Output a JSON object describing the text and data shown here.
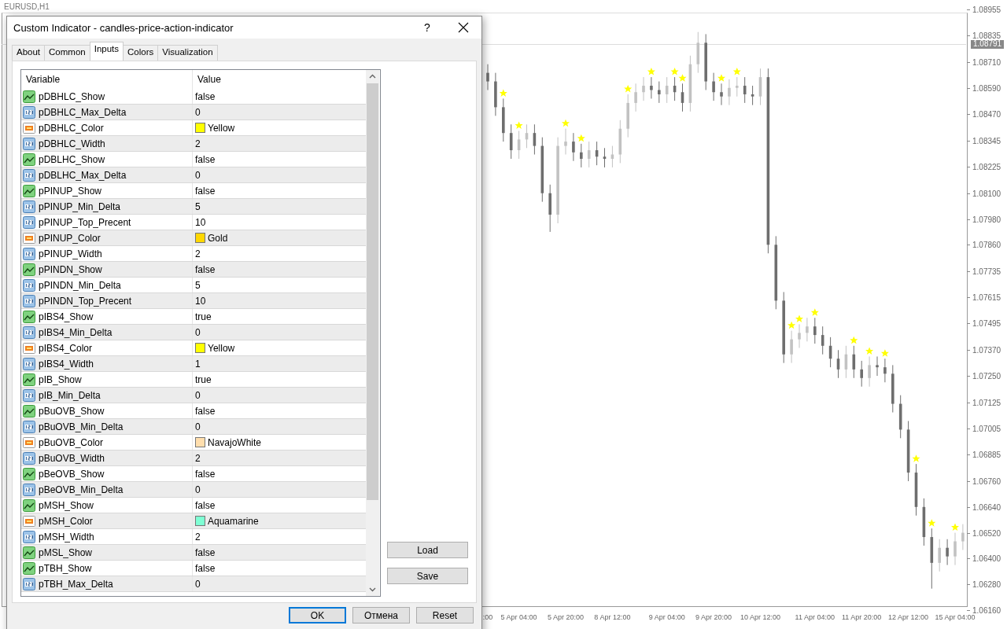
{
  "chart_window": {
    "title": "EURUSD,H1",
    "current_price": "1.08791",
    "chart_data": {
      "type": "candlestick",
      "ylim": [
        1.0616,
        1.08955
      ],
      "categories": [
        ":00",
        null,
        null,
        null,
        "5 Apr 04:00",
        null,
        null,
        null,
        null,
        null,
        "5 Apr 20:00",
        null,
        null,
        null,
        null,
        null,
        "8 Apr 12:00",
        null,
        null,
        null,
        null,
        null,
        null,
        "9 Apr 04:00",
        null,
        null,
        null,
        null,
        null,
        "9 Apr 20:00",
        null,
        null,
        null,
        null,
        null,
        "10 Apr 12:00",
        null,
        null,
        null,
        null,
        null,
        null,
        "11 Apr 04:00",
        null,
        null,
        null,
        null,
        null,
        "11 Apr 20:00",
        null,
        null,
        null,
        null,
        null,
        "12 Apr 12:00",
        null,
        null,
        null,
        null,
        null,
        "15 Apr 04:00",
        null
      ],
      "ohlc": [
        [
          1.0866,
          1.087,
          1.0858,
          1.0862
        ],
        [
          1.0862,
          1.0866,
          1.0846,
          1.085
        ],
        [
          1.085,
          1.0854,
          1.0834,
          1.0838
        ],
        [
          1.0838,
          1.0842,
          1.0826,
          1.083
        ],
        [
          1.083,
          1.0839,
          1.0826,
          1.0835
        ],
        [
          1.0835,
          1.0842,
          1.0831,
          1.0838
        ],
        [
          1.0838,
          1.0842,
          1.0828,
          1.0832
        ],
        [
          1.0832,
          1.0836,
          1.0806,
          1.081
        ],
        [
          1.081,
          1.0814,
          1.0792,
          1.08
        ],
        [
          1.08,
          1.0836,
          1.0796,
          1.0832
        ],
        [
          1.0832,
          1.084,
          1.0828,
          1.0834
        ],
        [
          1.0834,
          1.0838,
          1.0825,
          1.0829
        ],
        [
          1.0829,
          1.0833,
          1.0822,
          1.0826
        ],
        [
          1.0826,
          1.0834,
          1.0822,
          1.083
        ],
        [
          1.083,
          1.0834,
          1.0823,
          1.0827
        ],
        [
          1.0827,
          1.0831,
          1.0822,
          1.0826
        ],
        [
          1.0826,
          1.0832,
          1.0822,
          1.0828
        ],
        [
          1.0828,
          1.0844,
          1.0824,
          1.084
        ],
        [
          1.084,
          1.0856,
          1.0836,
          1.0852
        ],
        [
          1.0852,
          1.0861,
          1.0848,
          1.0857
        ],
        [
          1.0857,
          1.0864,
          1.0853,
          1.086
        ],
        [
          1.086,
          1.0864,
          1.0854,
          1.0858
        ],
        [
          1.0858,
          1.0862,
          1.0852,
          1.0856
        ],
        [
          1.0856,
          1.0864,
          1.0852,
          1.086
        ],
        [
          1.086,
          1.0864,
          1.0853,
          1.0857
        ],
        [
          1.0857,
          1.0861,
          1.0848,
          1.0852
        ],
        [
          1.0852,
          1.0874,
          1.0848,
          1.087
        ],
        [
          1.087,
          1.0885,
          1.0866,
          1.088
        ],
        [
          1.088,
          1.0884,
          1.0858,
          1.0862
        ],
        [
          1.0862,
          1.0866,
          1.0853,
          1.0857
        ],
        [
          1.0857,
          1.0861,
          1.0851,
          1.0855
        ],
        [
          1.0855,
          1.0863,
          1.0851,
          1.0859
        ],
        [
          1.0859,
          1.0864,
          1.0855,
          1.086
        ],
        [
          1.086,
          1.0864,
          1.0852,
          1.0856
        ],
        [
          1.0856,
          1.086,
          1.0851,
          1.0855
        ],
        [
          1.0855,
          1.0868,
          1.0851,
          1.0864
        ],
        [
          1.0864,
          1.0868,
          1.0782,
          1.0786
        ],
        [
          1.0786,
          1.079,
          1.0756,
          1.076
        ],
        [
          1.076,
          1.0764,
          1.0731,
          1.0735
        ],
        [
          1.0735,
          1.0746,
          1.0731,
          1.0742
        ],
        [
          1.0742,
          1.0749,
          1.0738,
          1.0745
        ],
        [
          1.0745,
          1.0752,
          1.0741,
          1.0748
        ],
        [
          1.0748,
          1.0752,
          1.074,
          1.0744
        ],
        [
          1.0744,
          1.0748,
          1.0735,
          1.0739
        ],
        [
          1.0739,
          1.0743,
          1.0729,
          1.0733
        ],
        [
          1.0733,
          1.0737,
          1.0724,
          1.0728
        ],
        [
          1.0728,
          1.0739,
          1.0724,
          1.0735
        ],
        [
          1.0735,
          1.0739,
          1.0724,
          1.0728
        ],
        [
          1.0728,
          1.0732,
          1.072,
          1.0724
        ],
        [
          1.0724,
          1.0734,
          1.072,
          1.073
        ],
        [
          1.073,
          1.0734,
          1.0725,
          1.0729
        ],
        [
          1.0729,
          1.0733,
          1.0722,
          1.0726
        ],
        [
          1.0726,
          1.073,
          1.0708,
          1.0712
        ],
        [
          1.0712,
          1.0716,
          1.0696,
          1.07
        ],
        [
          1.07,
          1.0704,
          1.0676,
          1.068
        ],
        [
          1.068,
          1.0684,
          1.066,
          1.0664
        ],
        [
          1.0664,
          1.0668,
          1.0646,
          1.065
        ],
        [
          1.065,
          1.0654,
          1.0626,
          1.0638
        ],
        [
          1.0638,
          1.0649,
          1.0634,
          1.0645
        ],
        [
          1.0645,
          1.0649,
          1.0637,
          1.0641
        ],
        [
          1.0641,
          1.0652,
          1.0637,
          1.0648
        ],
        [
          1.0648,
          1.0656,
          1.0644,
          1.0652
        ]
      ],
      "yticks": [
        {
          "value": 1.08955,
          "label": "1.08955"
        },
        {
          "value": 1.08835,
          "label": "1.08835"
        },
        {
          "value": 1.0871,
          "label": "1.08710"
        },
        {
          "value": 1.0859,
          "label": "1.08590"
        },
        {
          "value": 1.0847,
          "label": "1.08470"
        },
        {
          "value": 1.08345,
          "label": "1.08345"
        },
        {
          "value": 1.08225,
          "label": "1.08225"
        },
        {
          "value": 1.081,
          "label": "1.08100"
        },
        {
          "value": 1.0798,
          "label": "1.07980"
        },
        {
          "value": 1.0786,
          "label": "1.07860"
        },
        {
          "value": 1.07735,
          "label": "1.07735"
        },
        {
          "value": 1.07615,
          "label": "1.07615"
        },
        {
          "value": 1.07495,
          "label": "1.07495"
        },
        {
          "value": 1.0737,
          "label": "1.07370"
        },
        {
          "value": 1.0725,
          "label": "1.07250"
        },
        {
          "value": 1.07125,
          "label": "1.07125"
        },
        {
          "value": 1.07005,
          "label": "1.07005"
        },
        {
          "value": 1.06885,
          "label": "1.06885"
        },
        {
          "value": 1.0676,
          "label": "1.06760"
        },
        {
          "value": 1.0664,
          "label": "1.06640"
        },
        {
          "value": 1.0652,
          "label": "1.06520"
        },
        {
          "value": 1.064,
          "label": "1.06400"
        },
        {
          "value": 1.0628,
          "label": "1.06280"
        },
        {
          "value": 1.0616,
          "label": "1.06160"
        }
      ]
    }
  },
  "dialog": {
    "title": "Custom Indicator - candles-price-action-indicator",
    "help": "?",
    "tabs": [
      {
        "label": "About",
        "selected": false
      },
      {
        "label": "Common",
        "selected": false
      },
      {
        "label": "Inputs",
        "selected": true
      },
      {
        "label": "Colors",
        "selected": false
      },
      {
        "label": "Visualization",
        "selected": false
      }
    ],
    "table": {
      "columns": [
        "Variable",
        "Value"
      ],
      "rows": [
        {
          "kind": "bool",
          "variable": "pDBHLC_Show",
          "value": "false"
        },
        {
          "kind": "int",
          "variable": "pDBHLC_Max_Delta",
          "value": "0"
        },
        {
          "kind": "color",
          "variable": "pDBHLC_Color",
          "value": "Yellow",
          "color": "#ffff00"
        },
        {
          "kind": "int",
          "variable": "pDBHLC_Width",
          "value": "2"
        },
        {
          "kind": "bool",
          "variable": "pDBLHC_Show",
          "value": "false"
        },
        {
          "kind": "int",
          "variable": "pDBLHC_Max_Delta",
          "value": "0"
        },
        {
          "kind": "bool",
          "variable": "pPINUP_Show",
          "value": "false"
        },
        {
          "kind": "int",
          "variable": "pPINUP_Min_Delta",
          "value": "5"
        },
        {
          "kind": "int",
          "variable": "pPINUP_Top_Precent",
          "value": "10"
        },
        {
          "kind": "color",
          "variable": "pPINUP_Color",
          "value": "Gold",
          "color": "#ffd700"
        },
        {
          "kind": "int",
          "variable": "pPINUP_Width",
          "value": "2"
        },
        {
          "kind": "bool",
          "variable": "pPINDN_Show",
          "value": "false"
        },
        {
          "kind": "int",
          "variable": "pPINDN_Min_Delta",
          "value": "5"
        },
        {
          "kind": "int",
          "variable": "pPINDN_Top_Precent",
          "value": "10"
        },
        {
          "kind": "bool",
          "variable": "pIBS4_Show",
          "value": "true"
        },
        {
          "kind": "int",
          "variable": "pIBS4_Min_Delta",
          "value": "0"
        },
        {
          "kind": "color",
          "variable": "pIBS4_Color",
          "value": "Yellow",
          "color": "#ffff00"
        },
        {
          "kind": "int",
          "variable": "pIBS4_Width",
          "value": "1"
        },
        {
          "kind": "bool",
          "variable": "pIB_Show",
          "value": "true"
        },
        {
          "kind": "int",
          "variable": "pIB_Min_Delta",
          "value": "0"
        },
        {
          "kind": "bool",
          "variable": "pBuOVB_Show",
          "value": "false"
        },
        {
          "kind": "int",
          "variable": "pBuOVB_Min_Delta",
          "value": "0"
        },
        {
          "kind": "color",
          "variable": "pBuOVB_Color",
          "value": "NavajoWhite",
          "color": "#ffdead"
        },
        {
          "kind": "int",
          "variable": "pBuOVB_Width",
          "value": "2"
        },
        {
          "kind": "bool",
          "variable": "pBeOVB_Show",
          "value": "false"
        },
        {
          "kind": "int",
          "variable": "pBeOVB_Min_Delta",
          "value": "0"
        },
        {
          "kind": "bool",
          "variable": "pMSH_Show",
          "value": "false"
        },
        {
          "kind": "color",
          "variable": "pMSH_Color",
          "value": "Aquamarine",
          "color": "#7fffd4"
        },
        {
          "kind": "int",
          "variable": "pMSH_Width",
          "value": "2"
        },
        {
          "kind": "bool",
          "variable": "pMSL_Show",
          "value": "false"
        },
        {
          "kind": "bool",
          "variable": "pTBH_Show",
          "value": "false"
        },
        {
          "kind": "int",
          "variable": "pTBH_Max_Delta",
          "value": "0"
        }
      ]
    },
    "side_buttons": [
      "Load",
      "Save"
    ],
    "buttons": [
      {
        "label": "OK",
        "default": true
      },
      {
        "label": "Отмена",
        "default": false
      },
      {
        "label": "Reset",
        "default": false
      }
    ]
  }
}
